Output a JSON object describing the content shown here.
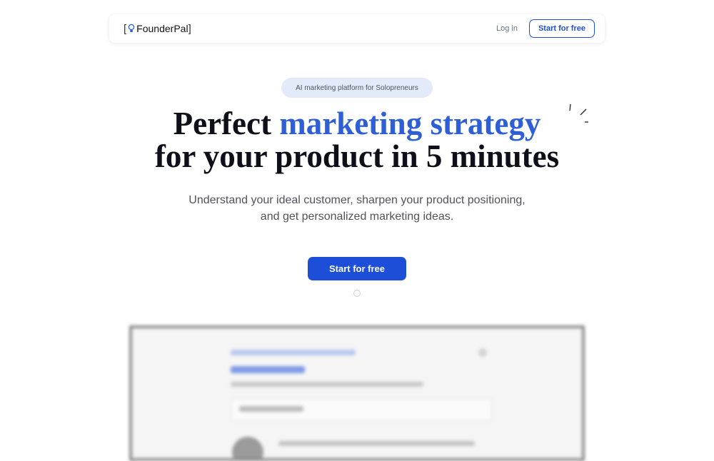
{
  "navbar": {
    "brand": "FounderPal",
    "bracket_open": "[",
    "bracket_close": "]",
    "login_label": "Log in",
    "cta_label": "Start for free"
  },
  "hero": {
    "badge": "AI marketing platform for Solopreneurs",
    "title_plain": "Perfect ",
    "title_accent": "marketing strategy",
    "title_line2": "for your product in 5 minutes",
    "subtitle_line1": "Understand your ideal customer, sharpen your product positioning,",
    "subtitle_line2": "and get personalized marketing ideas.",
    "cta_label": "Start for free"
  },
  "icons": [
    "lightbulb-icon",
    "sparkle-icon",
    "loading-icon"
  ],
  "colors": {
    "accent": "#2f5fd6",
    "primary_button": "#1d4ed8",
    "badge_bg": "#e3ebfa"
  }
}
